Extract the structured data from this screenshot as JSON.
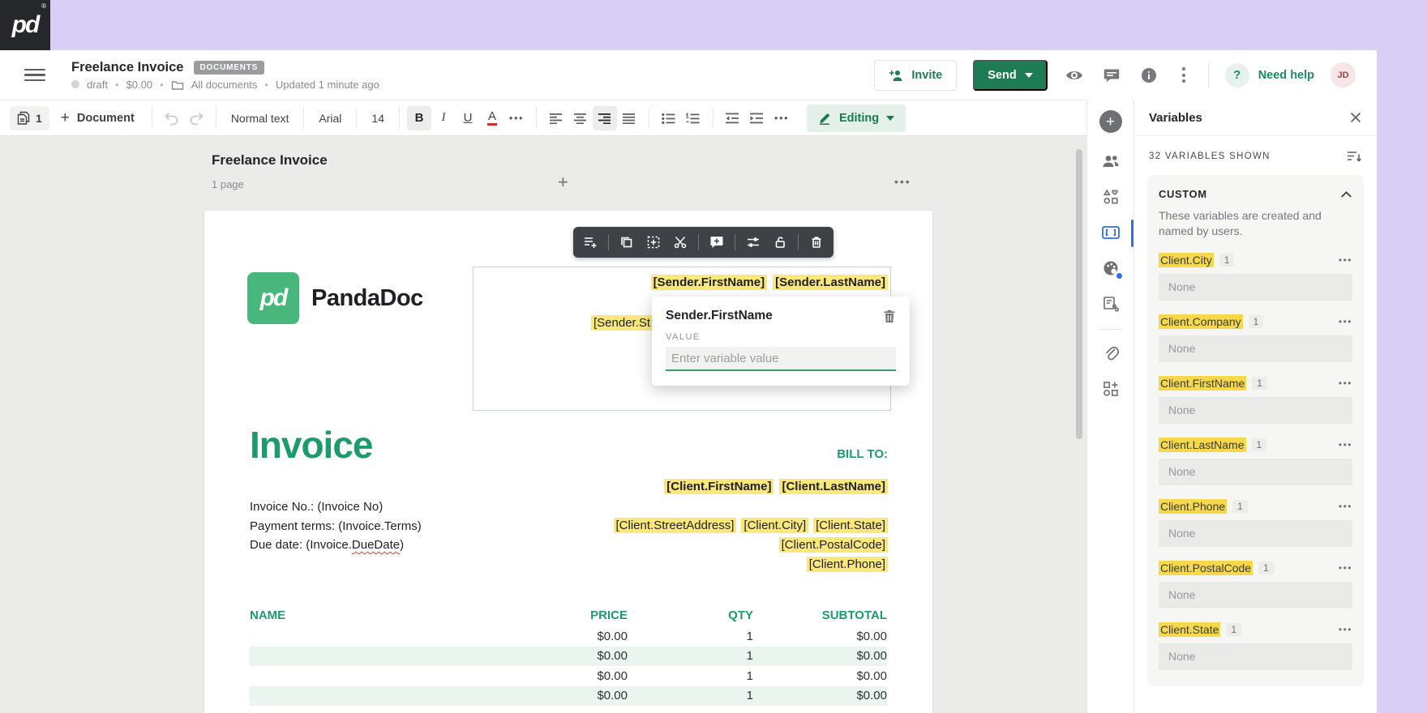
{
  "brand": {
    "logo": "pd",
    "registered": "®"
  },
  "header": {
    "title": "Freelance Invoice",
    "badge": "DOCUMENTS",
    "status": "draft",
    "amount": "$0.00",
    "folder": "All documents",
    "updated": "Updated 1 minute ago",
    "invite_label": "Invite",
    "send_label": "Send",
    "help_glyph": "?",
    "need_help_label": "Need help",
    "avatar_initials": "JD"
  },
  "toolbar": {
    "page_count": "1",
    "add_document_label": "Document",
    "paragraph_style": "Normal text",
    "font_family": "Arial",
    "font_size": "14",
    "bold": "B",
    "italic": "I",
    "underline": "U",
    "color": "A",
    "overflow": "•••",
    "mode_label": "Editing"
  },
  "canvas": {
    "document_title": "Freelance Invoice",
    "page_count_label": "1 page",
    "add_page_glyph": "+",
    "overflow": "•••"
  },
  "document": {
    "logo_text": "PandaDoc",
    "sender_first": "[Sender.FirstName]",
    "sender_last": "[Sender.LastName]",
    "sender_partial": "[Sender.St",
    "invoice_title": "Invoice",
    "bill_to": "BILL TO:",
    "client_first": "[Client.FirstName]",
    "client_last": "[Client.LastName]",
    "detail_invoice_no": "Invoice No.: (Invoice No)",
    "detail_payment_terms": "Payment terms: (Invoice.Terms)",
    "due_prefix": "Due date: (Invoice.",
    "due_word": "DueDate",
    "due_suffix": ")",
    "addr_street": "[Client.StreetAddress]",
    "addr_city": "[Client.City]",
    "addr_state": "[Client.State]",
    "addr_postal": "[Client.PostalCode]",
    "addr_phone": "[Client.Phone]",
    "table": {
      "headers": [
        "NAME",
        "PRICE",
        "QTY",
        "SUBTOTAL"
      ],
      "rows": [
        {
          "name": "",
          "price": "$0.00",
          "qty": "1",
          "subtotal": "$0.00"
        },
        {
          "name": "",
          "price": "$0.00",
          "qty": "1",
          "subtotal": "$0.00"
        },
        {
          "name": "",
          "price": "$0.00",
          "qty": "1",
          "subtotal": "$0.00"
        },
        {
          "name": "",
          "price": "$0.00",
          "qty": "1",
          "subtotal": "$0.00"
        }
      ]
    }
  },
  "popup": {
    "title": "Sender.FirstName",
    "value_label": "VALUE",
    "placeholder": "Enter variable value"
  },
  "panel": {
    "title": "Variables",
    "shown_label": "32 VARIABLES SHOWN",
    "section_title": "CUSTOM",
    "section_description": "These variables are created and named by users.",
    "variables": [
      {
        "name": "Client.City",
        "count": "1",
        "value": "None"
      },
      {
        "name": "Client.Company",
        "count": "1",
        "value": "None"
      },
      {
        "name": "Client.FirstName",
        "count": "1",
        "value": "None"
      },
      {
        "name": "Client.LastName",
        "count": "1",
        "value": "None"
      },
      {
        "name": "Client.Phone",
        "count": "1",
        "value": "None"
      },
      {
        "name": "Client.PostalCode",
        "count": "1",
        "value": "None"
      },
      {
        "name": "Client.State",
        "count": "1",
        "value": "None"
      }
    ]
  },
  "colors": {
    "brand_green": "#1E7C55",
    "doc_green": "#1E9B6B",
    "doc_highlight": "#FAE87D",
    "panel_highlight": "#F6D94A",
    "topbar_lavender": "#D8CEF6",
    "active_blue": "#2F6FE4"
  }
}
